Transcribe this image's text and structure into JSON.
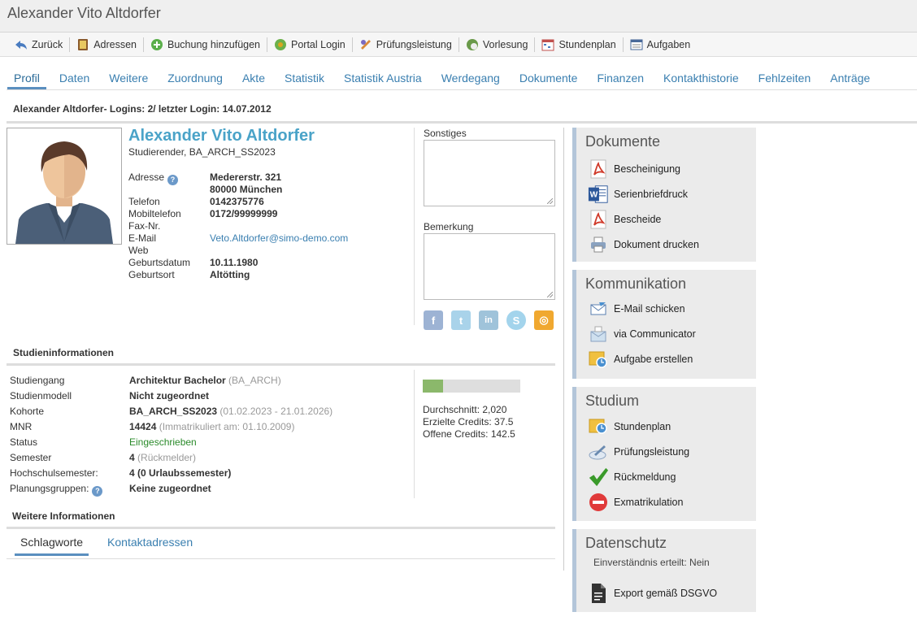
{
  "window": {
    "title": "Alexander Vito Altdorfer"
  },
  "toolbar": {
    "items": [
      {
        "label": "Zurück",
        "icon": "back-icon"
      },
      {
        "label": "Adressen",
        "icon": "address-book-icon"
      },
      {
        "label": "Buchung hinzufügen",
        "icon": "add-icon"
      },
      {
        "label": "Portal Login",
        "icon": "portal-icon"
      },
      {
        "label": "Prüfungsleistung",
        "icon": "exam-icon"
      },
      {
        "label": "Vorlesung",
        "icon": "lecture-icon"
      },
      {
        "label": "Stundenplan",
        "icon": "timetable-icon"
      },
      {
        "label": "Aufgaben",
        "icon": "tasks-icon"
      }
    ]
  },
  "tabs": [
    {
      "label": "Profil",
      "active": true
    },
    {
      "label": "Daten"
    },
    {
      "label": "Weitere"
    },
    {
      "label": "Zuordnung"
    },
    {
      "label": "Akte"
    },
    {
      "label": "Statistik"
    },
    {
      "label": "Statistik Austria"
    },
    {
      "label": "Werdegang"
    },
    {
      "label": "Dokumente"
    },
    {
      "label": "Finanzen"
    },
    {
      "label": "Kontakthistorie"
    },
    {
      "label": "Fehlzeiten"
    },
    {
      "label": "Anträge"
    }
  ],
  "login_info": "Alexander Altdorfer- Logins: 2/ letzter Login: 14.07.2012",
  "profile": {
    "name": "Alexander Vito Altdorfer",
    "subtitle": "Studierender, BA_ARCH_SS2023",
    "fields": {
      "adresse_label": "Adresse",
      "adresse_line1": "Medererstr. 321",
      "adresse_line2": "80000 München",
      "telefon_label": "Telefon",
      "telefon": "0142375776",
      "mobil_label": "Mobiltelefon",
      "mobil": "0172/99999999",
      "fax_label": "Fax-Nr.",
      "email_label": "E-Mail",
      "email": "Veto.Altdorfer@simo-demo.com",
      "web_label": "Web",
      "geburtsdatum_label": "Geburtsdatum",
      "geburtsdatum": "10.11.1980",
      "geburtsort_label": "Geburtsort",
      "geburtsort": "Altötting"
    }
  },
  "notes": {
    "sonstiges_label": "Sonstiges",
    "bemerkung_label": "Bemerkung"
  },
  "social": [
    {
      "icon": "facebook-icon",
      "glyph": "f",
      "color": "#9db3d4"
    },
    {
      "icon": "twitter-icon",
      "glyph": "t",
      "color": "#a9d3ea"
    },
    {
      "icon": "linkedin-icon",
      "glyph": "in",
      "color": "#9fc3da"
    },
    {
      "icon": "skype-icon",
      "glyph": "S",
      "color": "#a3d4ec"
    },
    {
      "icon": "xing-icon",
      "glyph": "◎",
      "color": "#f0a830"
    }
  ],
  "study": {
    "title": "Studieninformationen",
    "studiengang_label": "Studiengang",
    "studiengang": "Architektur Bachelor",
    "studiengang_code": "(BA_ARCH)",
    "studienmodell_label": "Studienmodell",
    "studienmodell": "Nicht zugeordnet",
    "kohorte_label": "Kohorte",
    "kohorte": "BA_ARCH_SS2023",
    "kohorte_range": "(01.02.2023 - 21.01.2026)",
    "mnr_label": "MNR",
    "mnr": "14424",
    "mnr_note": "(Immatrikuliert am: 01.10.2009)",
    "status_label": "Status",
    "status": "Eingeschrieben",
    "semester_label": "Semester",
    "semester": "4",
    "semester_note": "(Rückmelder)",
    "hochschulsemester_label": "Hochschulsemester:",
    "hochschulsemester": "4 (0 Urlaubssemester)",
    "planungsgruppen_label": "Planungsgruppen:",
    "planungsgruppen": "Keine zugeordnet",
    "progress_fraction": 0.21,
    "durchschnitt": "Durchschnitt: 2,020",
    "erzielte_credits": "Erzielte Credits: 37.5",
    "offene_credits": "Offene Credits: 142.5"
  },
  "weitere": {
    "title": "Weitere Informationen",
    "subtabs": [
      {
        "label": "Schlagworte",
        "active": true
      },
      {
        "label": "Kontaktadressen"
      }
    ]
  },
  "panels": {
    "dokumente": {
      "title": "Dokumente",
      "items": [
        {
          "label": "Bescheinigung",
          "icon": "pdf-icon"
        },
        {
          "label": "Serienbriefdruck",
          "icon": "word-icon"
        },
        {
          "label": "Bescheide",
          "icon": "pdf-icon"
        },
        {
          "label": "Dokument drucken",
          "icon": "printer-icon"
        }
      ]
    },
    "kommunikation": {
      "title": "Kommunikation",
      "items": [
        {
          "label": "E-Mail schicken",
          "icon": "email-icon"
        },
        {
          "label": "via Communicator",
          "icon": "communicator-icon"
        },
        {
          "label": "Aufgabe erstellen",
          "icon": "task-clock-icon"
        }
      ]
    },
    "studium": {
      "title": "Studium",
      "items": [
        {
          "label": "Stundenplan",
          "icon": "timetable-clock-icon"
        },
        {
          "label": "Prüfungsleistung",
          "icon": "exam-icon"
        },
        {
          "label": "Rückmeldung",
          "icon": "checkmark-icon"
        },
        {
          "label": "Exmatrikulation",
          "icon": "stop-icon"
        }
      ]
    },
    "datenschutz": {
      "title": "Datenschutz",
      "consent": "Einverständnis erteilt: Nein",
      "export_label": "Export gemäß DSGVO",
      "export_icon": "document-icon"
    }
  },
  "colors": {
    "accent": "#3a7fb0",
    "name": "#4aa3c8",
    "status_green": "#2a8a2a",
    "panel_bg": "#ebebeb",
    "panel_border": "#b3c5d9"
  }
}
